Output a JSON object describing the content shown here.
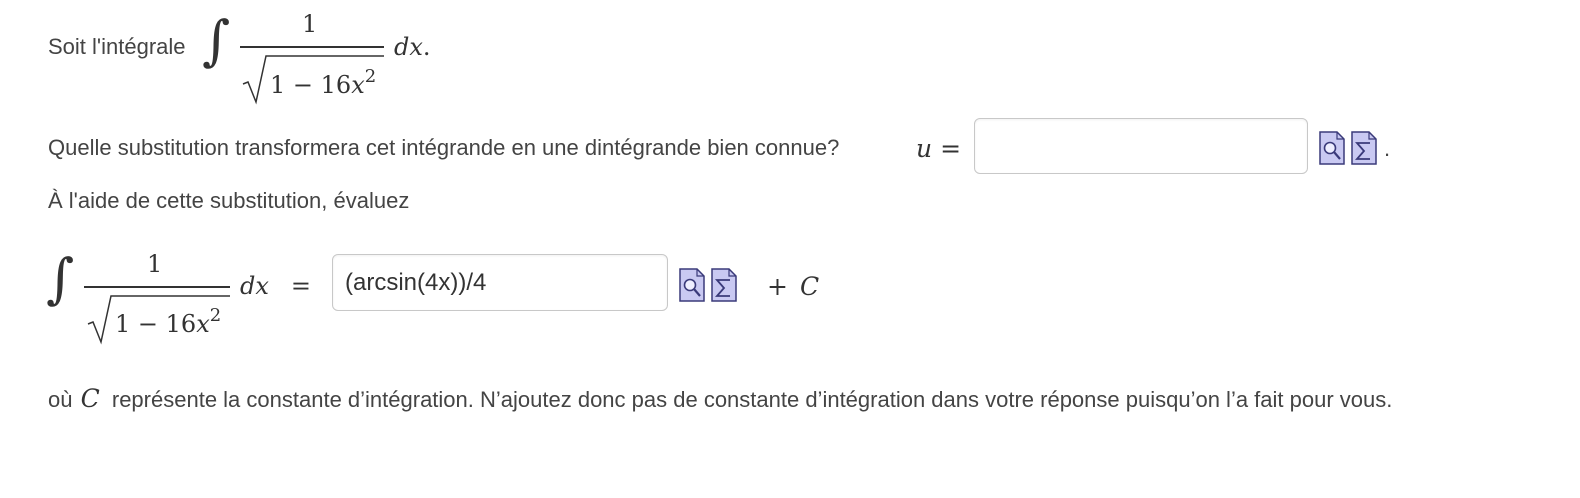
{
  "line1": {
    "prefix": "Soit l'intégrale",
    "integrand_numerator": "1",
    "integrand_radicand_prefix": "1 − 16",
    "integrand_radicand_var": "x",
    "integrand_radicand_exp": "2",
    "differential": "dx",
    "trailing": "."
  },
  "question": {
    "text": "Quelle substitution transformera cet intégrande en une dintégrande bien connue?",
    "var": "u",
    "eq": "=",
    "input_value": "",
    "trailing": "."
  },
  "instruction": {
    "text": "À l'aide de cette substitution, évaluez"
  },
  "evaluation": {
    "numerator": "1",
    "radicand_prefix": "1 − 16",
    "radicand_var": "x",
    "radicand_exp": "2",
    "differential": "dx",
    "eq": "=",
    "input_value": "(arcsin(4x))/4",
    "plus": "+",
    "constant": "C"
  },
  "footer": {
    "prefix": "où",
    "constant": "C",
    "text": "représente la constante d’intégration. N’ajoutez donc pas de constante d’intégration dans votre réponse puisqu’on l’a fait pour vous."
  },
  "icons": {
    "preview": "preview-magnifier-icon",
    "equation_editor": "sigma-equation-editor-icon"
  },
  "colors": {
    "icon_fill": "#c9c9f2",
    "icon_stroke": "#3a3a7a",
    "text": "#444444",
    "input_border": "#c8c8c8"
  }
}
